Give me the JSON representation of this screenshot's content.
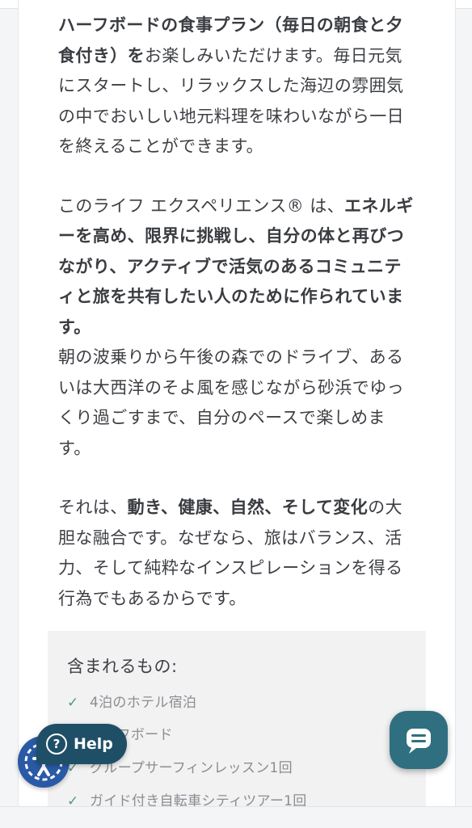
{
  "article": {
    "p1": [
      {
        "text": "ハーフボードの食事プラン（毎日の朝食と夕食付き）を",
        "bold": true
      },
      {
        "text": "お楽しみいただけます。毎日元気にスタートし、リラックスした海辺の雰囲気の中でおいしい地元料理を味わいながら一日を終えることができます。",
        "bold": false
      }
    ],
    "p2": [
      {
        "text": "このライフ エクスペリエンス® は、",
        "bold": false
      },
      {
        "text": "エネルギーを高め、限界に挑戦し、自分の体と再びつながり、アクティブで活気のあるコミュニティと旅を共有したい人のために作られています。",
        "bold": true
      }
    ],
    "p2b": [
      {
        "text": "朝の波乗りから午後の森でのドライブ、あるいは大西洋のそよ風を感じながら砂浜でゆっくり過ごすまで、自分のペースで楽しめます。",
        "bold": false
      }
    ],
    "p3": [
      {
        "text": "それは、",
        "bold": false
      },
      {
        "text": "動き、健康、自然、そして変化",
        "bold": true
      },
      {
        "text": "の大胆な融合です。なぜなら、旅はバランス、活力、そして純粋なインスピレーションを得る行為でもあるからです。",
        "bold": false
      }
    ]
  },
  "included": {
    "title": "含まれるもの:",
    "items": [
      "4泊のホテル宿泊",
      "ハーフボード",
      "グループサーフィンレッスン1回",
      "ガイド付き自転車シティツアー1回"
    ]
  },
  "widgets": {
    "help_label": "Help",
    "help_icon": "question-circle-icon",
    "accessibility_icon": "accessibility-icon",
    "chat_icon": "chat-bubble-icon"
  },
  "colors": {
    "text": "#3d3f44",
    "muted": "#8b8d92",
    "check": "#4a9a8a",
    "help_bg": "#1f4f66",
    "chat_bg": "#2f6f80",
    "access_bg": "#2a5aa6"
  }
}
